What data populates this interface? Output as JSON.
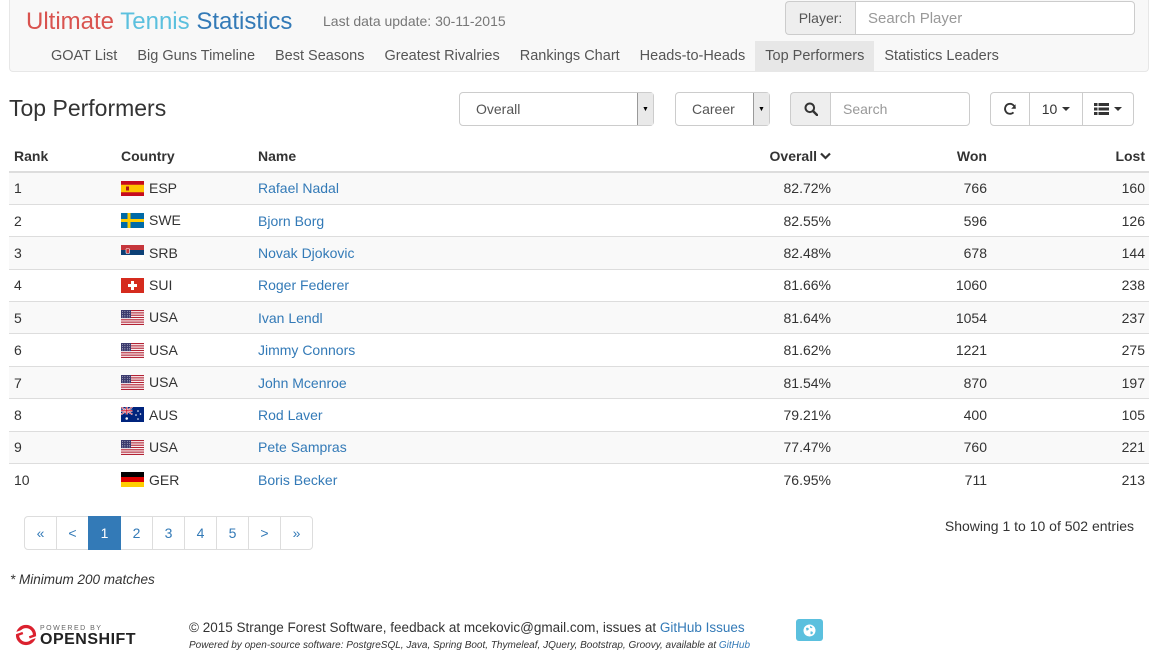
{
  "brand": {
    "part1": "Ultimate",
    "part2": "Tennis",
    "part3": "Statistics"
  },
  "last_update": "Last data update: 30-11-2015",
  "player_search": {
    "label": "Player:",
    "placeholder": "Search Player"
  },
  "nav": [
    {
      "label": "GOAT List",
      "active": false
    },
    {
      "label": "Big Guns Timeline",
      "active": false
    },
    {
      "label": "Best Seasons",
      "active": false
    },
    {
      "label": "Greatest Rivalries",
      "active": false
    },
    {
      "label": "Rankings Chart",
      "active": false
    },
    {
      "label": "Heads-to-Heads",
      "active": false
    },
    {
      "label": "Top Performers",
      "active": true
    },
    {
      "label": "Statistics Leaders",
      "active": false
    }
  ],
  "page_title": "Top Performers",
  "filters": {
    "category": "Overall",
    "period": "Career"
  },
  "search": {
    "placeholder": "Search"
  },
  "toolbar": {
    "rows_per_page": "10",
    "refresh_icon": "refresh-icon",
    "columns_icon": "columns-icon"
  },
  "table": {
    "headers": {
      "rank": "Rank",
      "country": "Country",
      "name": "Name",
      "overall": "Overall",
      "won": "Won",
      "lost": "Lost"
    },
    "sort_column": "overall",
    "rows": [
      {
        "rank": "1",
        "country": "ESP",
        "name": "Rafael Nadal",
        "overall": "82.72%",
        "won": "766",
        "lost": "160"
      },
      {
        "rank": "2",
        "country": "SWE",
        "name": "Bjorn Borg",
        "overall": "82.55%",
        "won": "596",
        "lost": "126"
      },
      {
        "rank": "3",
        "country": "SRB",
        "name": "Novak Djokovic",
        "overall": "82.48%",
        "won": "678",
        "lost": "144"
      },
      {
        "rank": "4",
        "country": "SUI",
        "name": "Roger Federer",
        "overall": "81.66%",
        "won": "1060",
        "lost": "238"
      },
      {
        "rank": "5",
        "country": "USA",
        "name": "Ivan Lendl",
        "overall": "81.64%",
        "won": "1054",
        "lost": "237"
      },
      {
        "rank": "6",
        "country": "USA",
        "name": "Jimmy Connors",
        "overall": "81.62%",
        "won": "1221",
        "lost": "275"
      },
      {
        "rank": "7",
        "country": "USA",
        "name": "John Mcenroe",
        "overall": "81.54%",
        "won": "870",
        "lost": "197"
      },
      {
        "rank": "8",
        "country": "AUS",
        "name": "Rod Laver",
        "overall": "79.21%",
        "won": "400",
        "lost": "105"
      },
      {
        "rank": "9",
        "country": "USA",
        "name": "Pete Sampras",
        "overall": "77.47%",
        "won": "760",
        "lost": "221"
      },
      {
        "rank": "10",
        "country": "GER",
        "name": "Boris Becker",
        "overall": "76.95%",
        "won": "711",
        "lost": "213"
      }
    ]
  },
  "pagination": {
    "first": "«",
    "prev": "<",
    "pages": [
      "1",
      "2",
      "3",
      "4",
      "5"
    ],
    "current": "1",
    "next": ">",
    "last": "»"
  },
  "entries_info": "Showing 1 to 10 of 502 entries",
  "footnote": "* Minimum 200 matches",
  "footer": {
    "openshift_powered": "POWERED BY",
    "openshift_name": "OPENSHIFT",
    "line1_text": "© 2015 Strange Forest Software, feedback at mcekovic@gmail.com, issues at ",
    "line1_link": "GitHub Issues",
    "line2_text": "Powered by open-source software: PostgreSQL, Java, Spring Boot, Thymeleaf, JQuery, Bootstrap, Groovy, available at ",
    "line2_link": "GitHub"
  },
  "colors": {
    "brand_red": "#d9534f",
    "brand_teal": "#5bc0de",
    "brand_blue": "#337ab7",
    "link": "#337ab7",
    "active_page": "#337ab7"
  }
}
